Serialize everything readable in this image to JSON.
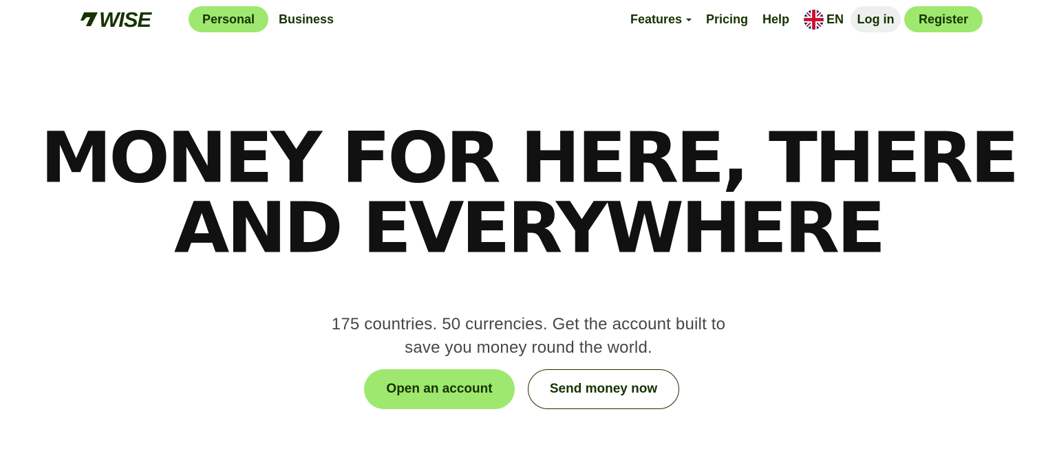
{
  "brand": {
    "logo_text": "WISE",
    "color": "#163300",
    "accent": "#9fe870",
    "logo_icon": "wise-flag-icon"
  },
  "nav": {
    "personal": "Personal",
    "business": "Business",
    "features": "Features",
    "pricing": "Pricing",
    "help": "Help",
    "language": "EN",
    "language_icon": "uk-flag-icon",
    "login": "Log in",
    "register": "Register"
  },
  "hero": {
    "title_line1": "MONEY FOR HERE, THERE",
    "title_line2": "AND EVERYWHERE",
    "subtitle_line1": "175 countries. 50 currencies. Get the account built to",
    "subtitle_line2": "save you money round the world.",
    "primary_cta": "Open an account",
    "secondary_cta": "Send money now"
  }
}
